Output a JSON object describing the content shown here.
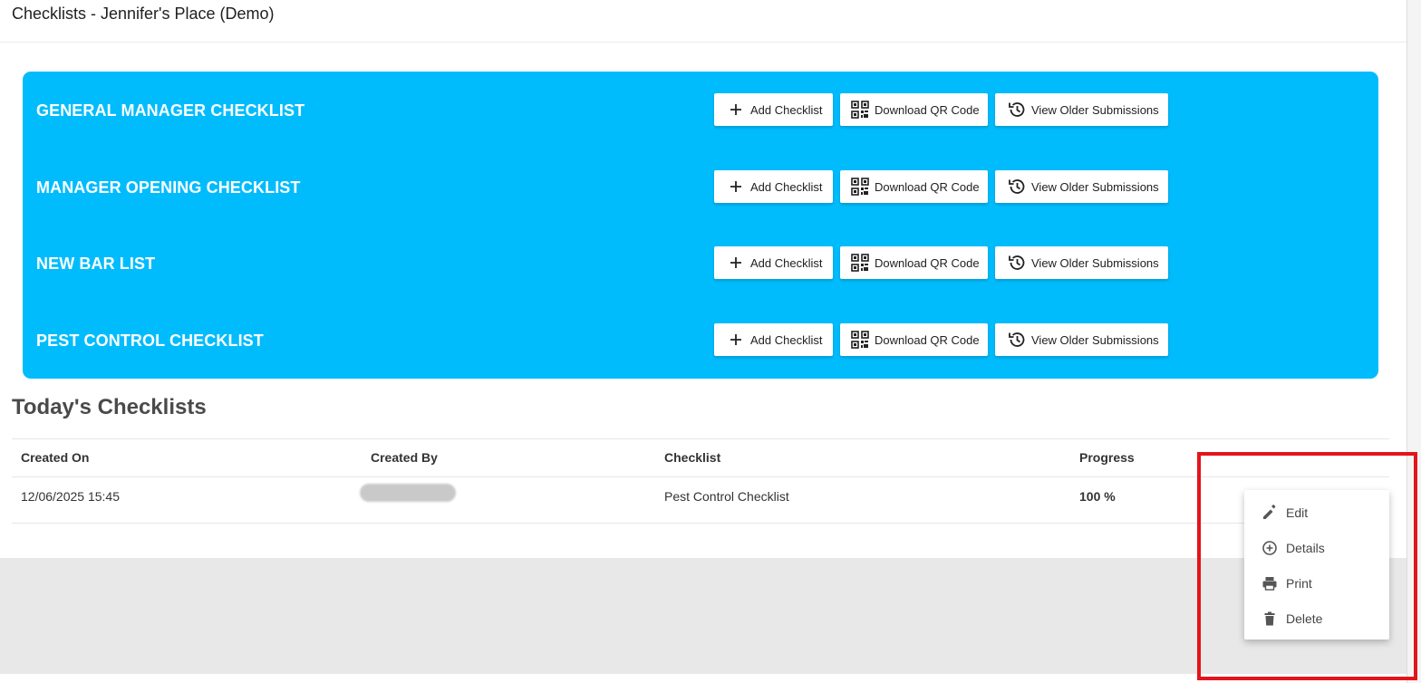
{
  "header": {
    "title": "Checklists - Jennifer's Place (Demo)"
  },
  "checklists": [
    {
      "name": "GENERAL MANAGER CHECKLIST"
    },
    {
      "name": "MANAGER OPENING CHECKLIST"
    },
    {
      "name": "NEW BAR LIST"
    },
    {
      "name": "PEST CONTROL CHECKLIST"
    }
  ],
  "buttons": {
    "add": "Add Checklist",
    "qr": "Download QR Code",
    "older": "View Older Submissions"
  },
  "today": {
    "title": "Today's Checklists",
    "columns": [
      "Created On",
      "Created By",
      "Checklist",
      "Progress"
    ],
    "rows": [
      {
        "created_on": "12/06/2025 15:45",
        "created_by": "",
        "checklist": "Pest Control Checklist",
        "progress": "100 %"
      }
    ]
  },
  "context_menu": {
    "items": [
      {
        "label": "Edit",
        "icon": "pencil-icon"
      },
      {
        "label": "Details",
        "icon": "plus-circle-icon"
      },
      {
        "label": "Print",
        "icon": "printer-icon"
      },
      {
        "label": "Delete",
        "icon": "trash-icon"
      }
    ]
  },
  "colors": {
    "panel_blue": "#00bcfd",
    "highlight_red": "#e3141b"
  }
}
